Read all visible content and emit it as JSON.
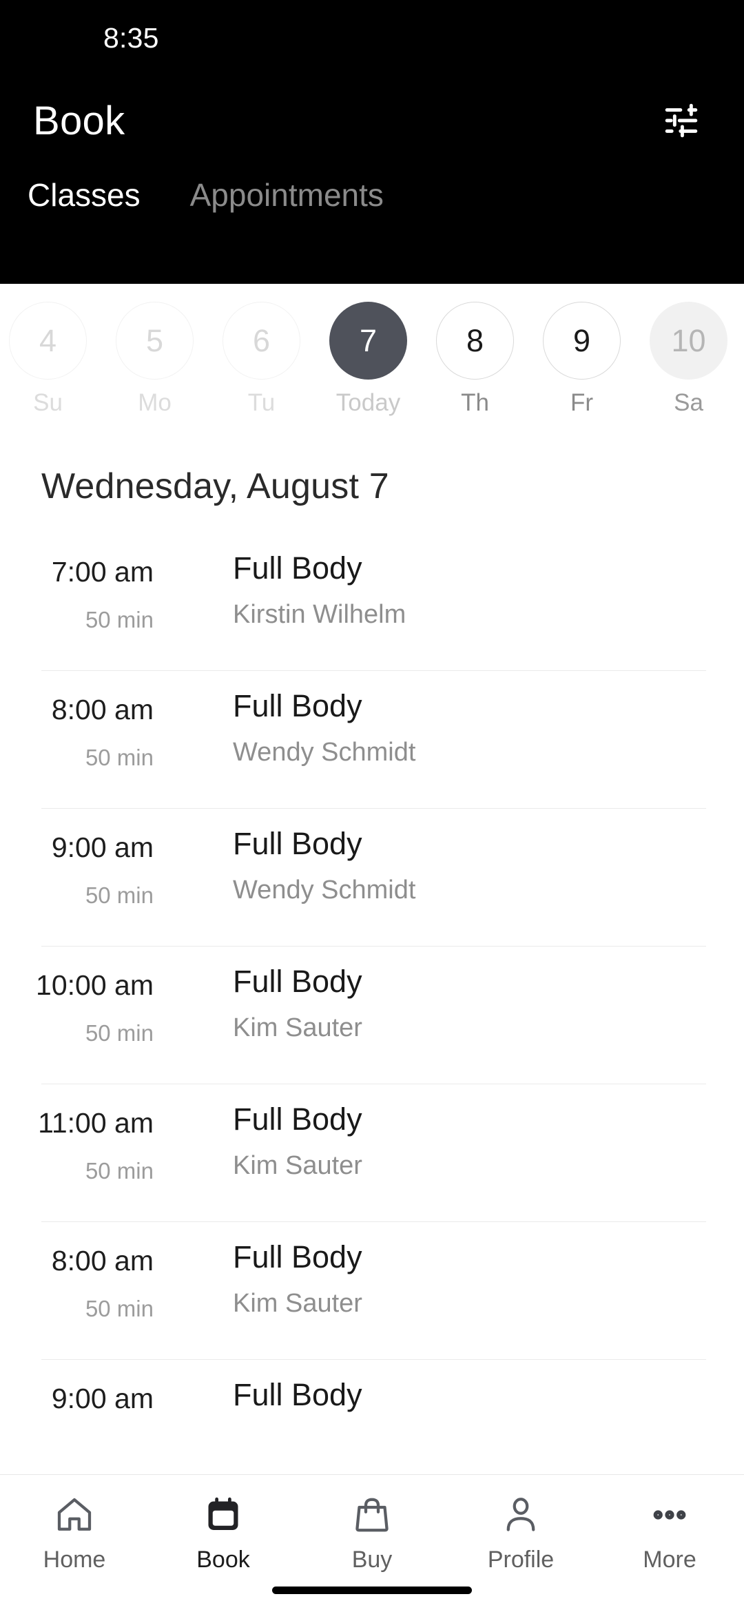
{
  "status_bar": {
    "time": "8:35"
  },
  "header": {
    "title": "Book",
    "filter_icon": "sliders-filter-icon",
    "background_color": "#000000"
  },
  "tabs": [
    {
      "label": "Classes",
      "active": true
    },
    {
      "label": "Appointments",
      "active": false
    }
  ],
  "date_strip": {
    "days": [
      {
        "num": "4",
        "label": "Su",
        "state": "past"
      },
      {
        "num": "5",
        "label": "Mo",
        "state": "past"
      },
      {
        "num": "6",
        "label": "Tu",
        "state": "past"
      },
      {
        "num": "7",
        "label": "Today",
        "state": "today"
      },
      {
        "num": "8",
        "label": "Th",
        "state": "future"
      },
      {
        "num": "9",
        "label": "Fr",
        "state": "future"
      },
      {
        "num": "10",
        "label": "Sa",
        "state": "muted"
      }
    ],
    "selected_color": "#4f525b"
  },
  "date_heading": "Wednesday, August 7",
  "classes": [
    {
      "time": "7:00 am",
      "duration": "50 min",
      "name": "Full Body",
      "instructor": "Kirstin Wilhelm"
    },
    {
      "time": "8:00 am",
      "duration": "50 min",
      "name": "Full Body",
      "instructor": "Wendy Schmidt"
    },
    {
      "time": "9:00 am",
      "duration": "50 min",
      "name": "Full Body",
      "instructor": "Wendy Schmidt"
    },
    {
      "time": "10:00 am",
      "duration": "50 min",
      "name": "Full Body",
      "instructor": "Kim Sauter"
    },
    {
      "time": "11:00 am",
      "duration": "50 min",
      "name": "Full Body",
      "instructor": "Kim Sauter"
    },
    {
      "time": "8:00 am",
      "duration": "50 min",
      "name": "Full Body",
      "instructor": "Kim Sauter"
    },
    {
      "time": "9:00 am",
      "duration": "",
      "name": "Full Body",
      "instructor": ""
    }
  ],
  "bottom_nav": [
    {
      "label": "Home",
      "icon": "home-icon",
      "active": false
    },
    {
      "label": "Book",
      "icon": "calendar-icon",
      "active": true
    },
    {
      "label": "Buy",
      "icon": "shopping-bag-icon",
      "active": false
    },
    {
      "label": "Profile",
      "icon": "person-icon",
      "active": false
    },
    {
      "label": "More",
      "icon": "ellipsis-icon",
      "active": false
    }
  ]
}
